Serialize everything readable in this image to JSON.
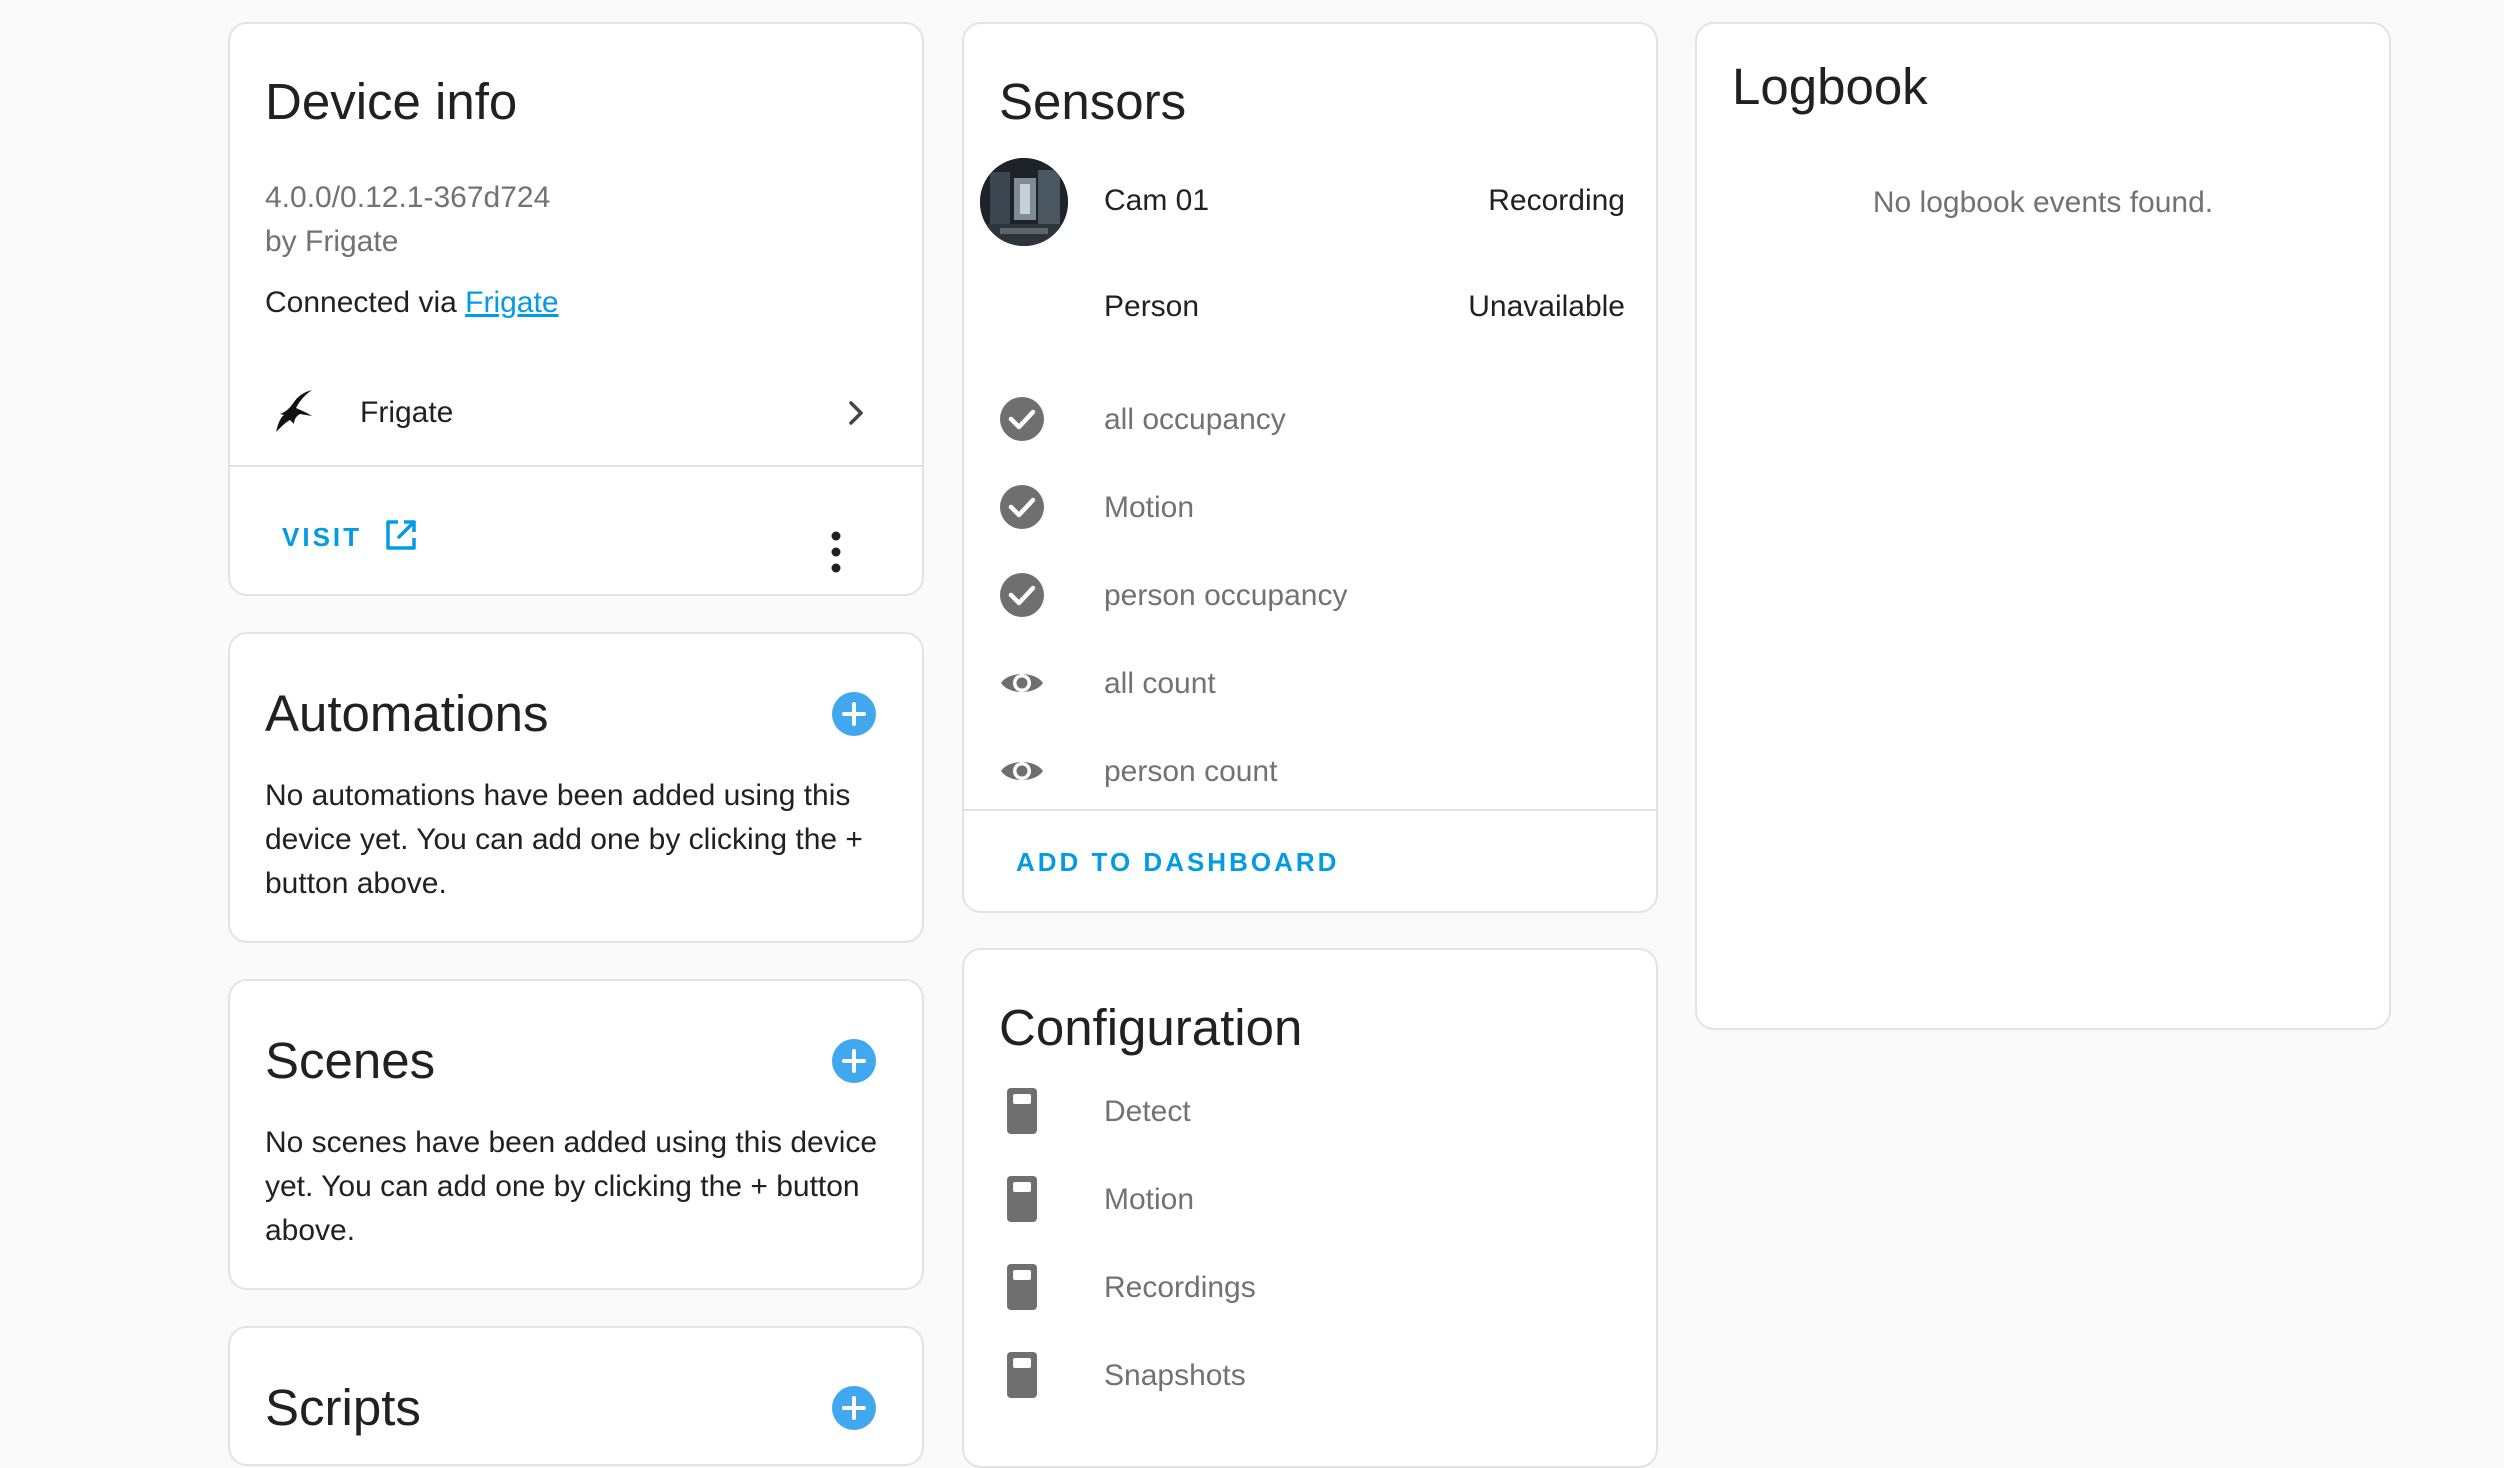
{
  "device_info": {
    "title": "Device info",
    "version": "4.0.0/0.12.1-367d724",
    "manufacturer": "by Frigate",
    "connected_prefix": "Connected via",
    "connected_link": "Frigate",
    "integration_name": "Frigate",
    "visit_label": "VISIT"
  },
  "automations": {
    "title": "Automations",
    "body": "No automations have been added using this device yet. You can add one by clicking the + button above."
  },
  "scenes": {
    "title": "Scenes",
    "body": "No scenes have been added using this device yet. You can add one by clicking the + button above."
  },
  "scripts": {
    "title": "Scripts"
  },
  "sensors": {
    "title": "Sensors",
    "rows": [
      {
        "name": "Cam 01",
        "state": "Recording",
        "icon": "camera-thumbnail"
      },
      {
        "name": "Person",
        "state": "Unavailable",
        "icon": "none"
      },
      {
        "name": "all occupancy",
        "state": "",
        "icon": "check-circle-icon"
      },
      {
        "name": "Motion",
        "state": "",
        "icon": "check-circle-icon"
      },
      {
        "name": "person occupancy",
        "state": "",
        "icon": "check-circle-icon"
      },
      {
        "name": "all count",
        "state": "",
        "icon": "eye-icon"
      },
      {
        "name": "person count",
        "state": "",
        "icon": "eye-icon"
      }
    ],
    "add_to_dashboard_label": "ADD TO DASHBOARD"
  },
  "configuration": {
    "title": "Configuration",
    "rows": [
      {
        "name": "Detect",
        "icon": "toggle-switch-icon"
      },
      {
        "name": "Motion",
        "icon": "toggle-switch-icon"
      },
      {
        "name": "Recordings",
        "icon": "toggle-switch-icon"
      },
      {
        "name": "Snapshots",
        "icon": "toggle-switch-icon"
      }
    ]
  },
  "logbook": {
    "title": "Logbook",
    "empty_message": "No logbook events found."
  },
  "colors": {
    "accent": "#039be5",
    "add_button": "#41a8f0",
    "icon_gray": "#6f6f6f",
    "muted_text": "#727272"
  }
}
